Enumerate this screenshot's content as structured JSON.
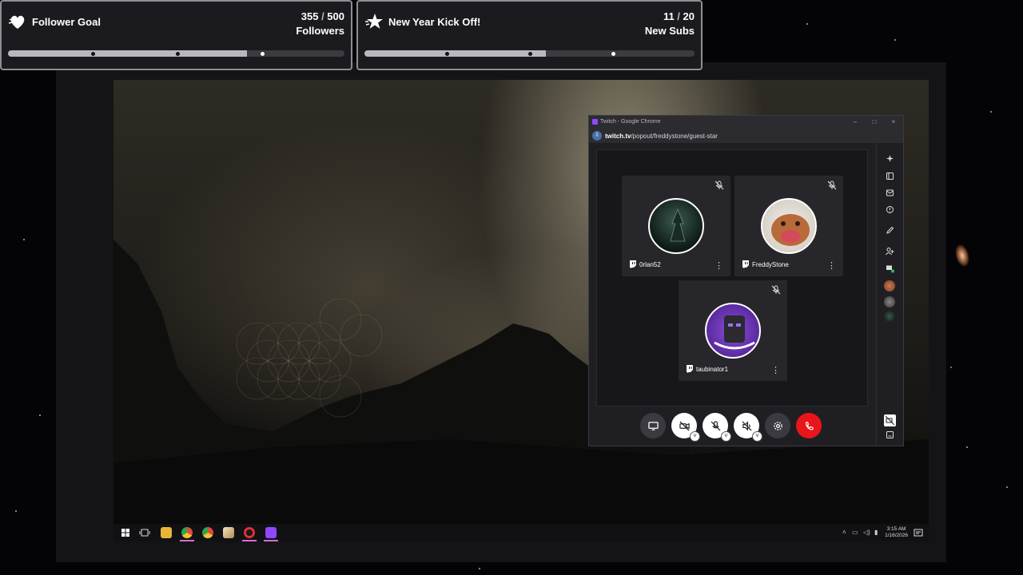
{
  "goals": [
    {
      "title": "Follower Goal",
      "icon": "heart-icon",
      "current": "355",
      "separator": " / ",
      "target": "500",
      "unit": "Followers",
      "progress": 0.71
    },
    {
      "title": "New Year Kick Off!",
      "icon": "star-icon",
      "current": "11",
      "separator": " / ",
      "target": "20",
      "unit": "New Subs",
      "progress": 0.55
    }
  ],
  "browser": {
    "window_title": "Twitch - Google Chrome",
    "url_domain": "twitch.tv",
    "url_path": "/popout/freddystone/guest-star"
  },
  "guests": [
    {
      "name": "0rlan52",
      "muted": true
    },
    {
      "name": "FreddyStone",
      "muted": true
    },
    {
      "name": "taubinator1",
      "muted": true
    }
  ],
  "controls": [
    {
      "name": "screen-share-button",
      "icon": "monitor-icon"
    },
    {
      "name": "camera-button",
      "icon": "camera-off-icon"
    },
    {
      "name": "microphone-button",
      "icon": "mic-off-icon"
    },
    {
      "name": "speaker-button",
      "icon": "speaker-off-icon"
    },
    {
      "name": "settings-button",
      "icon": "gear-icon"
    },
    {
      "name": "leave-call-button",
      "icon": "phone-hangup-icon"
    }
  ],
  "taskbar": {
    "time": "3:15 AM",
    "date": "1/16/2026"
  },
  "colors": {
    "accent_twitch": "#9147ff",
    "hangup_red": "#e8151b",
    "goal_border": "#8d8d95"
  }
}
